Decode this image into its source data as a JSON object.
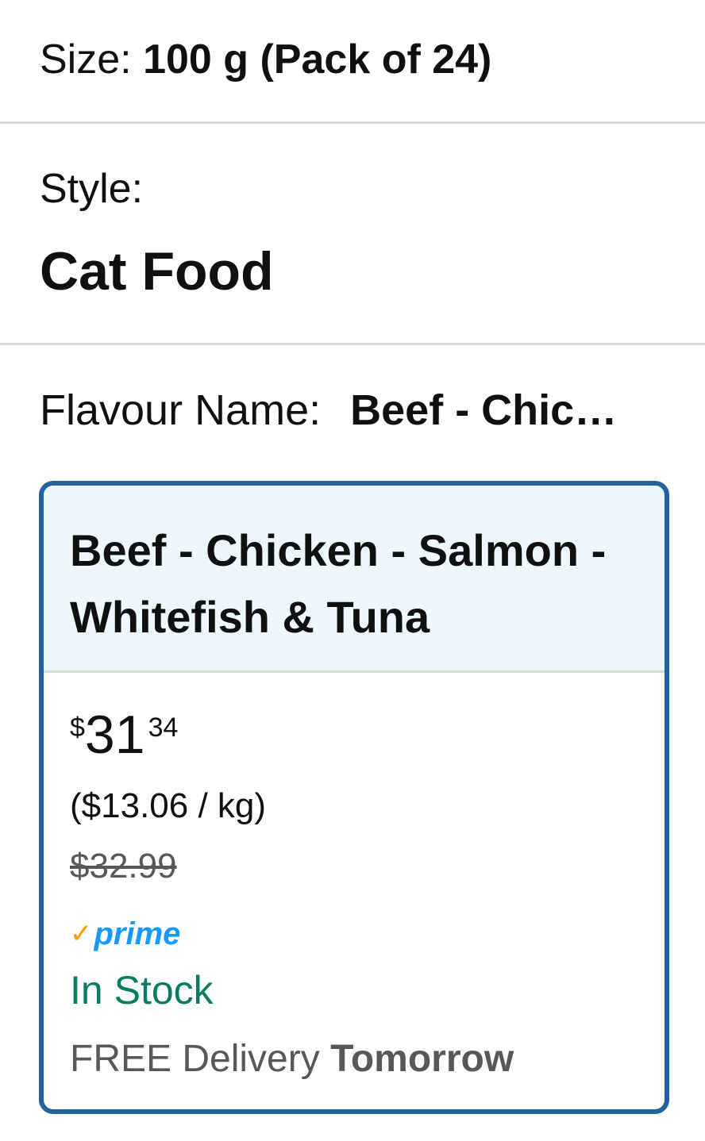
{
  "size": {
    "label": "Size:",
    "value": "100 g (Pack of 24)"
  },
  "style": {
    "label": "Style:",
    "value": "Cat Food"
  },
  "flavour": {
    "label": "Flavour Name:",
    "value": "Beef - Chic…"
  },
  "option_card": {
    "title": "Beef - Chicken - Salmon - Whitefish & Tuna",
    "price": {
      "symbol": "$",
      "whole": "31",
      "fraction": "34"
    },
    "unit_price": "($13.06 / kg)",
    "list_price": "$32.99",
    "prime": {
      "check": "✓",
      "label": "prime"
    },
    "stock": "In Stock",
    "delivery": {
      "prefix": "FREE Delivery",
      "when": "Tomorrow"
    }
  },
  "colors": {
    "card_border": "#2162a1",
    "card_header_bg": "#edf7fe",
    "in_stock": "#067d62",
    "prime_check": "#ff9900",
    "prime_text": "#1399ff"
  }
}
